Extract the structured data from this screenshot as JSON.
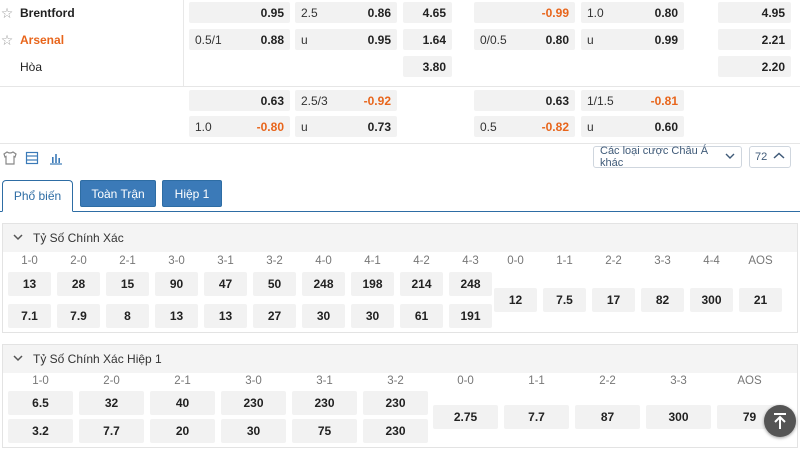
{
  "match": {
    "home": "Brentford",
    "away": "Arsenal",
    "draw": "Hòa"
  },
  "main_odds": {
    "home_row": [
      {
        "h": "",
        "v": "0.95"
      },
      {
        "h": "2.5",
        "v": "0.86"
      },
      {
        "h": "",
        "v": "4.65"
      },
      {
        "h": "",
        "v": "-0.99"
      },
      {
        "h": "1.0",
        "v": "0.80"
      },
      {
        "h": "",
        "v": "4.95"
      }
    ],
    "away_row": [
      {
        "h": "0.5/1",
        "v": "0.88"
      },
      {
        "h": "u",
        "v": "0.95"
      },
      {
        "h": "",
        "v": "1.64"
      },
      {
        "h": "0/0.5",
        "v": "0.80"
      },
      {
        "h": "u",
        "v": "0.99"
      },
      {
        "h": "",
        "v": "2.21"
      }
    ],
    "draw_row": [
      {
        "v": "3.80"
      },
      {
        "v": "2.20"
      }
    ],
    "alt1": [
      {
        "h": "",
        "v": "0.63"
      },
      {
        "h": "2.5/3",
        "v": "-0.92"
      },
      {
        "h": "",
        "v": "0.63"
      },
      {
        "h": "1/1.5",
        "v": "-0.81"
      }
    ],
    "alt2": [
      {
        "h": "1.0",
        "v": "-0.80"
      },
      {
        "h": "u",
        "v": "0.73"
      },
      {
        "h": "0.5",
        "v": "-0.82"
      },
      {
        "h": "u",
        "v": "0.60"
      }
    ]
  },
  "toolbar": {
    "dropdown_label": "Các loại cược Châu Á khác",
    "count": "72"
  },
  "tabs": [
    "Phổ biến",
    "Toàn Trận",
    "Hiệp 1"
  ],
  "exact_score": {
    "title": "Tỷ Số Chính Xác",
    "left_labels": [
      "1-0",
      "2-0",
      "2-1",
      "3-0",
      "3-1",
      "3-2",
      "4-0",
      "4-1",
      "4-2",
      "4-3"
    ],
    "left_home": [
      "13",
      "28",
      "15",
      "90",
      "47",
      "50",
      "248",
      "198",
      "214",
      "248"
    ],
    "left_away": [
      "7.1",
      "7.9",
      "8",
      "13",
      "13",
      "27",
      "30",
      "30",
      "61",
      "191"
    ],
    "right_labels": [
      "0-0",
      "1-1",
      "2-2",
      "3-3",
      "4-4",
      "AOS"
    ],
    "right_vals": [
      "12",
      "7.5",
      "17",
      "82",
      "300",
      "21"
    ]
  },
  "exact_score_h1": {
    "title": "Tỷ Số Chính Xác Hiệp 1",
    "left_labels": [
      "1-0",
      "2-0",
      "2-1",
      "3-0",
      "3-1",
      "3-2"
    ],
    "left_home": [
      "6.5",
      "32",
      "40",
      "230",
      "230",
      "230"
    ],
    "left_away": [
      "3.2",
      "7.7",
      "20",
      "30",
      "75",
      "230"
    ],
    "right_labels": [
      "0-0",
      "1-1",
      "2-2",
      "3-3",
      "AOS"
    ],
    "right_vals": [
      "2.75",
      "7.7",
      "87",
      "300",
      "79"
    ]
  },
  "colors": {
    "accent": "#3b7ab8",
    "negative": "#e8651b",
    "cell_bg": "#f2f2f2"
  }
}
